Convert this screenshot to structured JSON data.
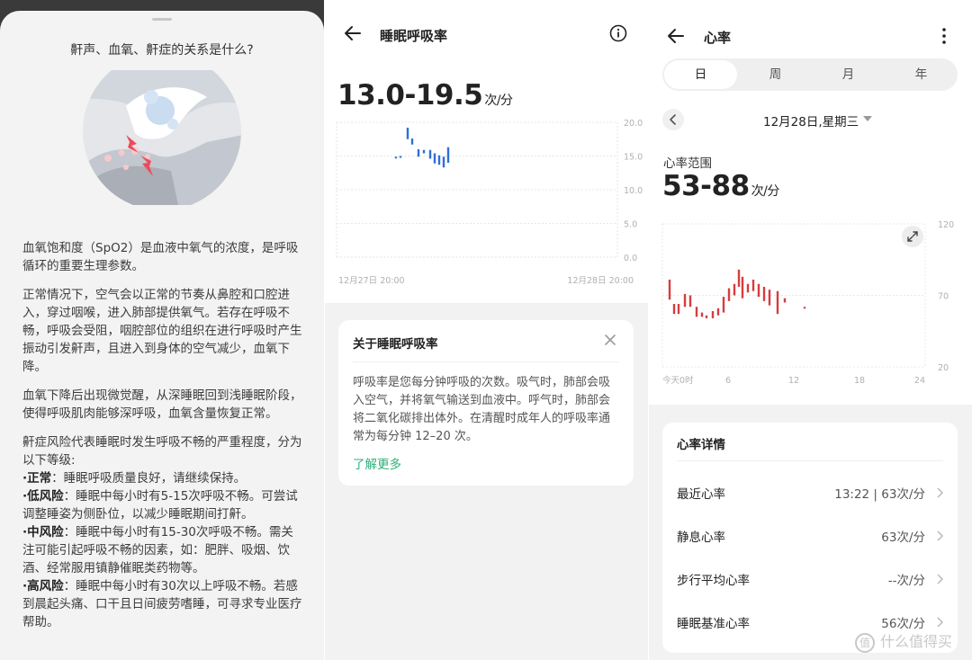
{
  "panel1": {
    "sheet_title": "鼾声、血氧、鼾症的关系是什么?",
    "para1": "血氧饱和度（SpO2）是血液中氧气的浓度，是呼吸循环的重要生理参数。",
    "para2": "正常情况下，空气会以正常的节奏从鼻腔和口腔进入，穿过咽喉，进入肺部提供氧气。若存在呼吸不畅，呼吸会受阻，咽腔部位的组织在进行呼吸时产生振动引发鼾声，且进入到身体的空气减少，血氧下降。",
    "para3": "血氧下降后出现微觉醒，从深睡眠回到浅睡眠阶段，使得呼吸肌肉能够深呼吸，血氧含量恢复正常。",
    "para4": "鼾症风险代表睡眠时发生呼吸不畅的严重程度，分为以下等级:",
    "levels": [
      {
        "name": "·正常",
        "desc": "：睡眠呼吸质量良好，请继续保持。"
      },
      {
        "name": "·低风险",
        "desc": "：睡眠中每小时有5-15次呼吸不畅。可尝试调整睡姿为侧卧位，以减少睡眠期间打鼾。"
      },
      {
        "name": "·中风险",
        "desc": "：睡眠中每小时有15-30次呼吸不畅。需关注可能引起呼吸不畅的因素，如：肥胖、吸烟、饮酒、经常服用镇静催眠类药物等。"
      },
      {
        "name": "·高风险",
        "desc": "：睡眠中每小时有30次以上呼吸不畅。若感到晨起头痛、口干且日间疲劳嗜睡，可寻求专业医疗帮助。"
      }
    ]
  },
  "panel2": {
    "title": "睡眠呼吸率",
    "range": "13.0-19.5",
    "unit": "次/分",
    "card": {
      "title": "关于睡眠呼吸率",
      "text": "呼吸率是您每分钟呼吸的次数。吸气时，肺部会吸入空气，并将氧气输送到血液中。呼气时，肺部会将二氧化碳排出体外。在清醒时成年人的呼吸率通常为每分钟 12–20 次。",
      "link": "了解更多"
    }
  },
  "panel3": {
    "title": "心率",
    "tabs": [
      "日",
      "周",
      "月",
      "年"
    ],
    "date": "12月28日,星期三",
    "range_label": "心率范围",
    "range": "53-88",
    "unit": "次/分",
    "card_title": "心率详情",
    "rows": [
      {
        "label": "最近心率",
        "value": "13:22 | 63次/分"
      },
      {
        "label": "静息心率",
        "value": "63次/分"
      },
      {
        "label": "步行平均心率",
        "value": "--次/分"
      },
      {
        "label": "睡眠基准心率",
        "value": "56次/分"
      }
    ]
  },
  "watermark": "什么值得买",
  "colors": {
    "breath_bar": "#2f6fd8",
    "heart_bar": "#d63d3d",
    "link": "#2db07a"
  },
  "chart_data": [
    {
      "type": "bar",
      "title": "睡眠呼吸率",
      "x_labels": [
        "12月27日 20:00",
        "12月28日 20:00"
      ],
      "ylim": [
        0,
        20
      ],
      "y_ticks": [
        "20.0",
        "15.0",
        "10.0",
        "5.0",
        "0.0"
      ],
      "series": [
        {
          "ranges": [
            [
              14.8,
              14.9
            ],
            [
              14.9,
              15.0
            ],
            [
              17.5,
              19.2
            ],
            [
              16.7,
              17.6
            ],
            [
              14.9,
              16.0
            ],
            [
              15.4,
              15.9
            ],
            [
              14.6,
              15.9
            ],
            [
              13.9,
              15.4
            ],
            [
              13.7,
              15.1
            ],
            [
              13.3,
              14.9
            ],
            [
              14.0,
              16.3
            ]
          ]
        }
      ]
    },
    {
      "type": "bar",
      "title": "心率",
      "x_labels": [
        "今天0时",
        "6",
        "12",
        "18",
        "24"
      ],
      "y_ticks": [
        "120",
        "70",
        "20"
      ],
      "ylim": [
        20,
        120
      ],
      "series": [
        {
          "ranges": [
            [
              67,
              81
            ],
            [
              57,
              64
            ],
            [
              57,
              64
            ],
            [
              62,
              71
            ],
            [
              62,
              70
            ],
            [
              55,
              62
            ],
            [
              55,
              58
            ],
            [
              54,
              56
            ],
            [
              54,
              59
            ],
            [
              56,
              61
            ],
            [
              58,
              69
            ],
            [
              66,
              75
            ],
            [
              70,
              78
            ],
            [
              76,
              88
            ],
            [
              68,
              83
            ],
            [
              72,
              78
            ],
            [
              73,
              81
            ],
            [
              69,
              78
            ],
            [
              66,
              76
            ],
            [
              63,
              74
            ],
            [
              57,
              73
            ],
            [
              65,
              68
            ],
            [
              61,
              62
            ]
          ]
        }
      ]
    }
  ]
}
